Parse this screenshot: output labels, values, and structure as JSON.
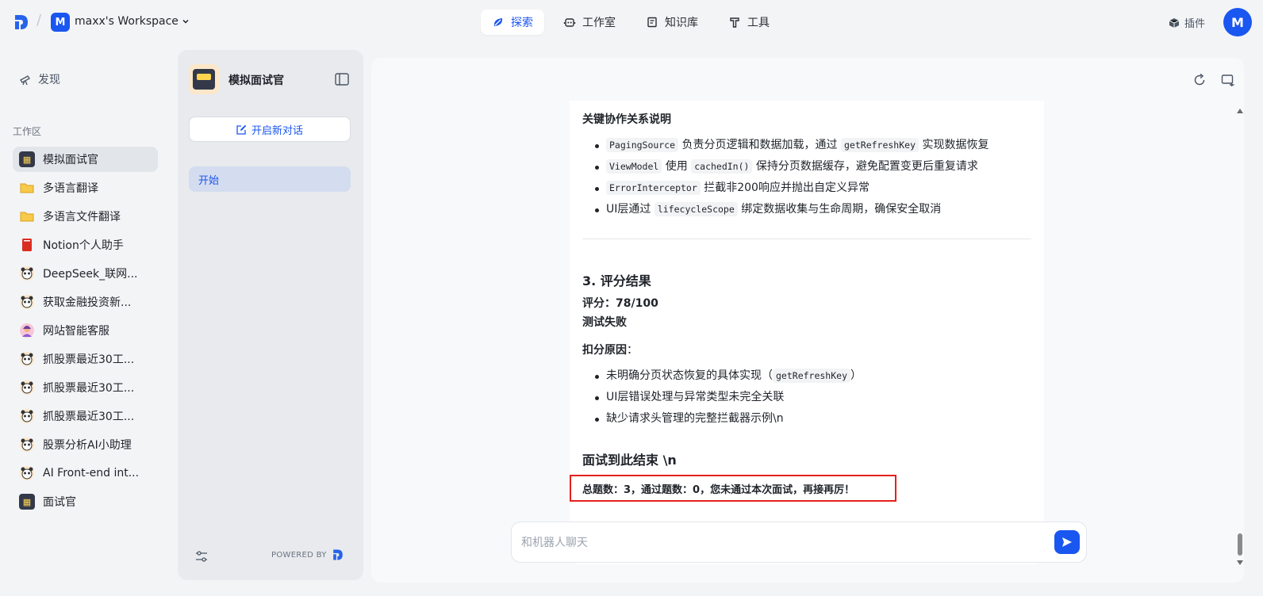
{
  "header": {
    "workspace_initial": "M",
    "workspace_name": "maxx's Workspace",
    "nav": [
      {
        "label": "探索",
        "active": true
      },
      {
        "label": "工作室",
        "active": false
      },
      {
        "label": "知识库",
        "active": false
      },
      {
        "label": "工具",
        "active": false
      }
    ],
    "plugin_label": "插件",
    "user_initial": "M"
  },
  "sidebar": {
    "discover_label": "发现",
    "workspace_label": "工作区",
    "items": [
      {
        "label": "模拟面试官",
        "icon": "robot-icon"
      },
      {
        "label": "多语言翻译",
        "icon": "folder-icon"
      },
      {
        "label": "多语言文件翻译",
        "icon": "folder-icon"
      },
      {
        "label": "Notion个人助手",
        "icon": "book-icon"
      },
      {
        "label": "DeepSeek_联网...",
        "icon": "panda-icon"
      },
      {
        "label": "获取金融投资新...",
        "icon": "panda-icon"
      },
      {
        "label": "网站智能客服",
        "icon": "service-icon"
      },
      {
        "label": "抓股票最近30工...",
        "icon": "panda-icon"
      },
      {
        "label": "抓股票最近30工...",
        "icon": "panda-icon"
      },
      {
        "label": "抓股票最近30工...",
        "icon": "panda-icon"
      },
      {
        "label": "股票分析AI小助理",
        "icon": "panda-icon"
      },
      {
        "label": "AI Front-end int...",
        "icon": "panda-icon"
      },
      {
        "label": "面试官",
        "icon": "robot-icon"
      }
    ]
  },
  "panel": {
    "bot_name": "模拟面试官",
    "new_chat_label": "开启新对话",
    "conversation_label": "开始",
    "powered_by": "POWERED BY"
  },
  "message": {
    "section_title": "关键协作关系说明",
    "relations": [
      {
        "code": "PagingSource",
        "text1": " 负责分页逻辑和数据加载，通过 ",
        "code2": "getRefreshKey",
        "text2": " 实现数据恢复"
      },
      {
        "code": "ViewModel",
        "text1": " 使用 ",
        "code2": "cachedIn()",
        "text2": " 保持分页数据缓存，避免配置变更后重复请求"
      },
      {
        "code": "ErrorInterceptor",
        "text1": " 拦截非200响应并抛出自定义异常",
        "code2": "",
        "text2": ""
      },
      {
        "pre": "UI层通过 ",
        "code": "lifecycleScope",
        "text1": " 绑定数据收集与生命周期，确保安全取消",
        "code2": "",
        "text2": ""
      }
    ],
    "result_title": "3. 评分结果",
    "score": "评分：78/100",
    "fail": "测试失败",
    "deduct_label": "扣分原因",
    "deduct_suffix": "：",
    "deductions": [
      {
        "text": "未明确分页状态恢复的具体实现（",
        "code": "getRefreshKey",
        "tail": "）"
      },
      {
        "text": "UI层错误处理与异常类型未完全关联",
        "code": "",
        "tail": ""
      },
      {
        "text": "缺少请求头管理的完整拦截器示例\\n",
        "code": "",
        "tail": ""
      }
    ],
    "end_title": "面试到此结束 \\n",
    "summary": "总题数：3，通过题数：0，您未通过本次面试，再接再厉！"
  },
  "input": {
    "placeholder": "和机器人聊天"
  },
  "colors": {
    "accent": "#1a56f0",
    "highlight_border": "#e5201c"
  }
}
